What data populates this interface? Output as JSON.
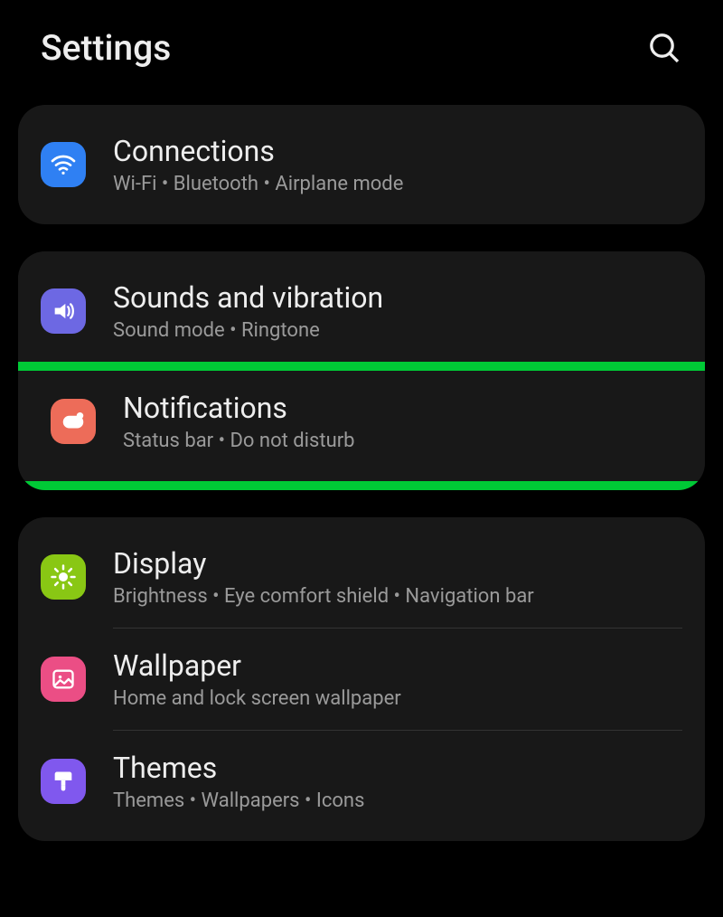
{
  "header": {
    "title": "Settings",
    "search_icon": "search"
  },
  "groups": [
    {
      "items": [
        {
          "id": "connections",
          "title": "Connections",
          "subtitle": "Wi-Fi  •  Bluetooth  •  Airplane mode"
        }
      ]
    },
    {
      "highlight_index": 1,
      "items": [
        {
          "id": "sounds",
          "title": "Sounds and vibration",
          "subtitle": "Sound mode  •  Ringtone"
        },
        {
          "id": "notifications",
          "title": "Notifications",
          "subtitle": "Status bar  •  Do not disturb"
        }
      ]
    },
    {
      "items": [
        {
          "id": "display",
          "title": "Display",
          "subtitle": "Brightness  •  Eye comfort shield  •  Navigation bar"
        },
        {
          "id": "wallpaper",
          "title": "Wallpaper",
          "subtitle": "Home and lock screen wallpaper"
        },
        {
          "id": "themes",
          "title": "Themes",
          "subtitle": "Themes  •  Wallpapers  •  Icons"
        }
      ]
    }
  ]
}
